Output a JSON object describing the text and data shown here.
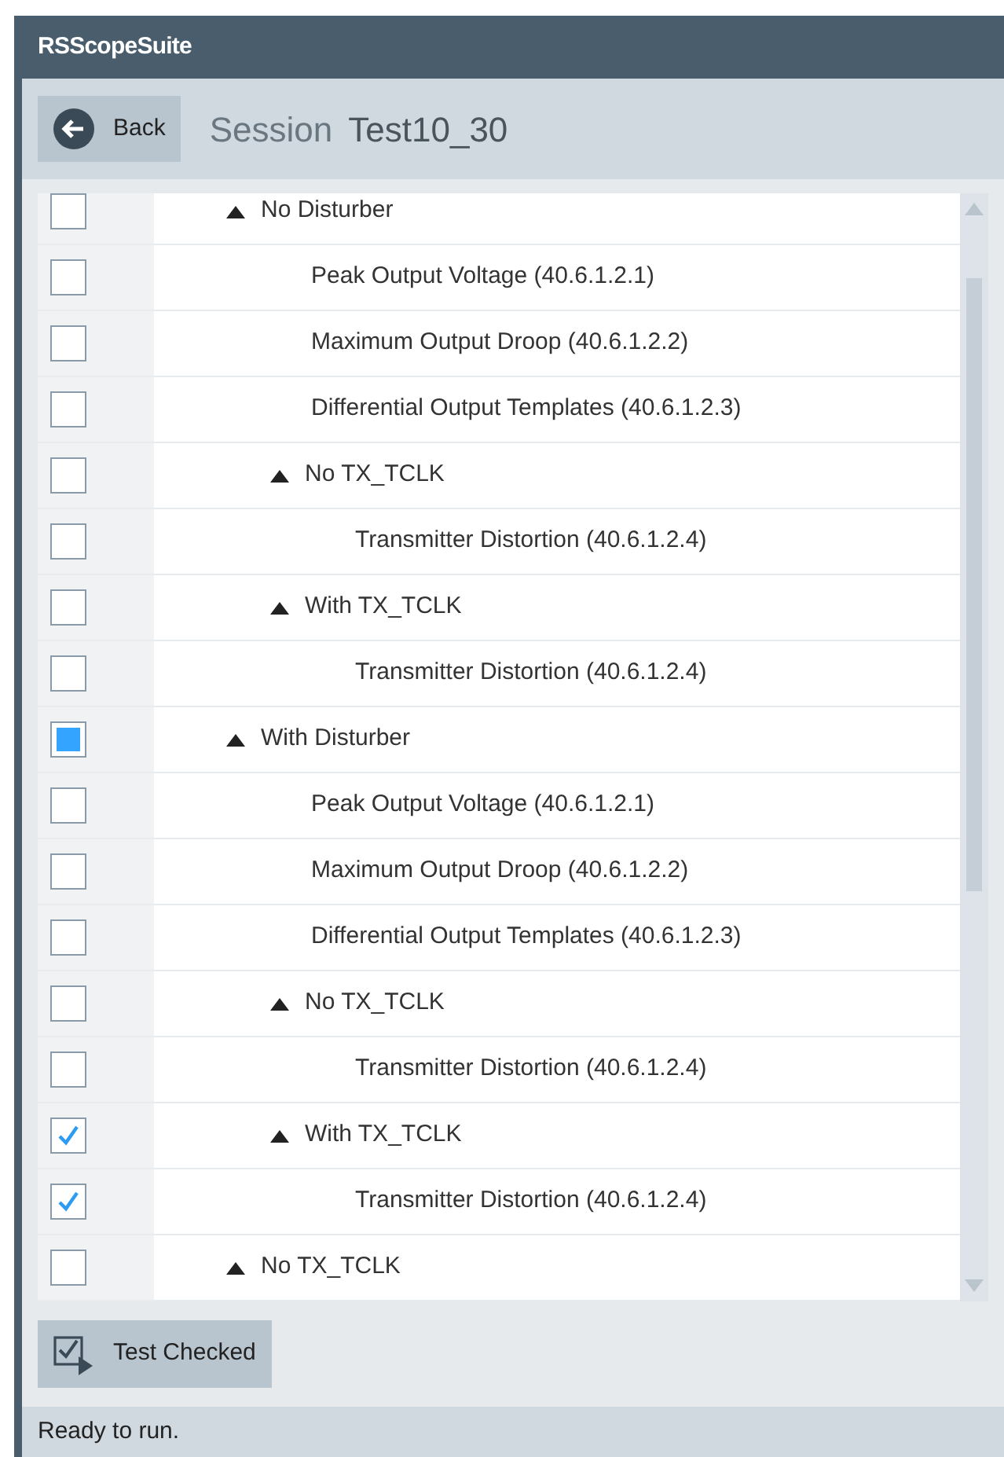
{
  "window": {
    "title": "RSScopeSuite"
  },
  "toolbar": {
    "back_button": "Back",
    "session_label": "Session",
    "session_name": "Test10_30"
  },
  "tree": [
    {
      "label": "No Disturber",
      "checked": false,
      "partial": false,
      "expanded": true,
      "children": [
        {
          "label": "Peak Output Voltage (40.6.1.2.1)",
          "checked": false,
          "partial": false
        },
        {
          "label": "Maximum Output Droop (40.6.1.2.2)",
          "checked": false,
          "partial": false
        },
        {
          "label": "Differential Output Templates (40.6.1.2.3)",
          "checked": false,
          "partial": false
        },
        {
          "label": "No TX_TCLK",
          "checked": false,
          "partial": false,
          "expanded": true,
          "children": [
            {
              "label": "Transmitter Distortion (40.6.1.2.4)",
              "checked": false,
              "partial": false
            }
          ]
        },
        {
          "label": "With TX_TCLK",
          "checked": false,
          "partial": false,
          "expanded": true,
          "children": [
            {
              "label": "Transmitter Distortion (40.6.1.2.4)",
              "checked": false,
              "partial": false
            }
          ]
        }
      ]
    },
    {
      "label": "With Disturber",
      "checked": false,
      "partial": true,
      "expanded": true,
      "children": [
        {
          "label": "Peak Output Voltage (40.6.1.2.1)",
          "checked": false,
          "partial": false
        },
        {
          "label": "Maximum Output Droop (40.6.1.2.2)",
          "checked": false,
          "partial": false
        },
        {
          "label": "Differential Output Templates (40.6.1.2.3)",
          "checked": false,
          "partial": false
        },
        {
          "label": "No TX_TCLK",
          "checked": false,
          "partial": false,
          "expanded": true,
          "children": [
            {
              "label": "Transmitter Distortion (40.6.1.2.4)",
              "checked": false,
              "partial": false
            }
          ]
        },
        {
          "label": "With TX_TCLK",
          "checked": true,
          "partial": false,
          "expanded": true,
          "children": [
            {
              "label": "Transmitter Distortion (40.6.1.2.4)",
              "checked": true,
              "partial": false
            }
          ]
        }
      ]
    },
    {
      "label": "No TX_TCLK",
      "checked": false,
      "partial": false,
      "expanded": true
    }
  ],
  "action_button": "Test Checked",
  "status_bar": "Ready to run."
}
